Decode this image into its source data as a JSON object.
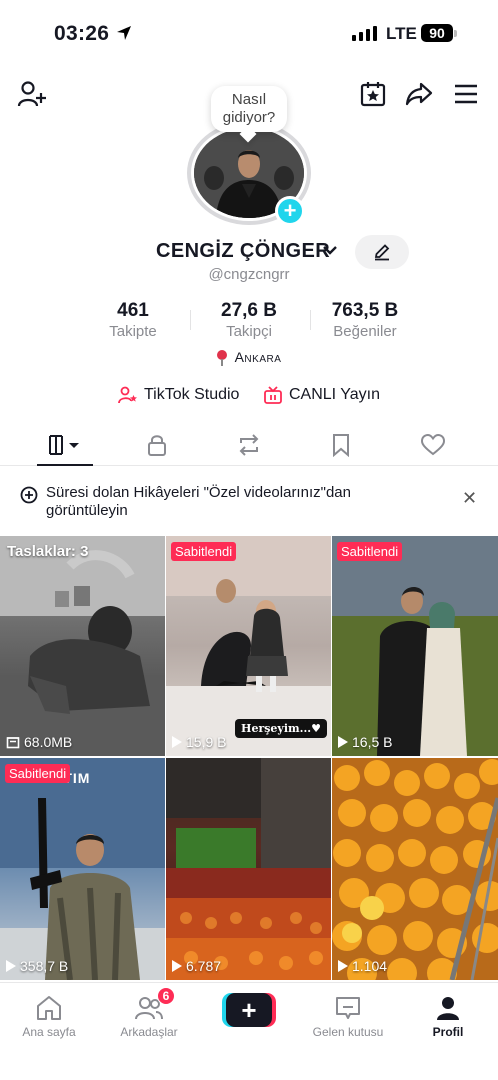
{
  "status_bar": {
    "time": "03:26",
    "network": "LTE",
    "battery": "90"
  },
  "profile": {
    "bubble_text": "Nasıl gidiyor?",
    "name": "CENGİZ ÇÖNGER",
    "handle": "@cngzcngrr",
    "location": "Ankara",
    "stats": [
      {
        "value": "461",
        "label": "Takipte"
      },
      {
        "value": "27,6 B",
        "label": "Takipçi"
      },
      {
        "value": "763,5 B",
        "label": "Beğeniler"
      }
    ],
    "links": [
      {
        "label": "TikTok Studio",
        "icon": "person-star-icon"
      },
      {
        "label": "CANLI Yayın",
        "icon": "live-tv-icon"
      }
    ]
  },
  "tabs": [
    {
      "icon": "videos-grid-icon",
      "active": true
    },
    {
      "icon": "lock-icon"
    },
    {
      "icon": "repost-icon"
    },
    {
      "icon": "bookmark-icon"
    },
    {
      "icon": "heart-icon"
    }
  ],
  "notice": {
    "text": "Süresi dolan Hikâyeleri \"Özel videolarınız\"dan görüntüleyin"
  },
  "grid": [
    {
      "drafts": "Taslaklar: 3",
      "meta": "68.0MB",
      "meta_icon": "archive-icon"
    },
    {
      "pinned": "Sabitlendi",
      "views": "15,9 B",
      "overlay": "Herşeyim...♥"
    },
    {
      "pinned": "Sabitlendi",
      "views": "16,5 B"
    },
    {
      "pinned": "Sabitlendi",
      "views": "358,7 B",
      "caption": "RAKTIM"
    },
    {
      "views": "6.787"
    },
    {
      "views": "1.104"
    }
  ],
  "bottom_nav": [
    {
      "label": "Ana sayfa",
      "icon": "home-icon"
    },
    {
      "label": "Arkadaşlar",
      "icon": "friends-icon",
      "badge": "6"
    },
    {
      "label": "",
      "icon": "plus-icon"
    },
    {
      "label": "Gelen kutusu",
      "icon": "inbox-icon"
    },
    {
      "label": "Profil",
      "icon": "profile-icon",
      "active": true
    }
  ],
  "colors": {
    "accent": "#fe2c55",
    "cyan": "#20d5ec",
    "text": "#161823",
    "muted": "#8a8b91"
  }
}
